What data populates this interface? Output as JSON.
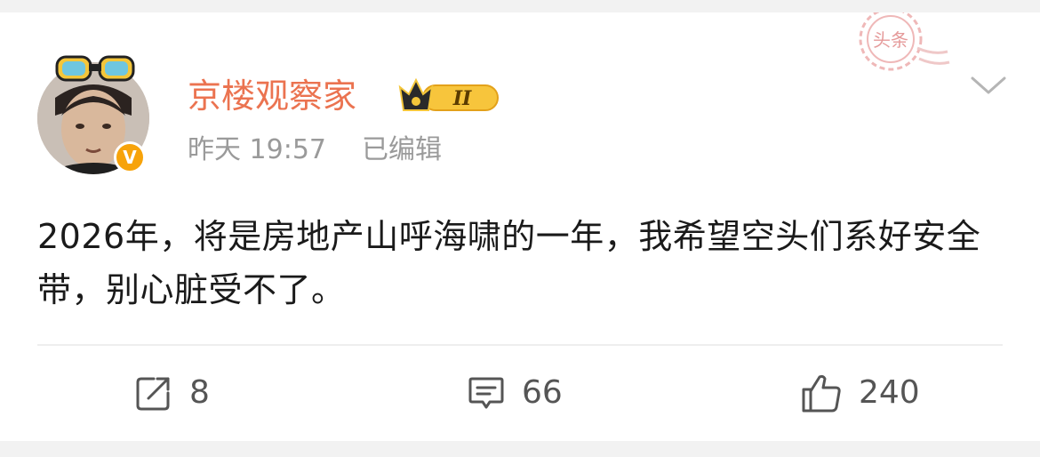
{
  "post": {
    "author": {
      "name": "京楼观察家",
      "verified_icon": "verified-v-badge",
      "verified_label": "V",
      "membership_icon": "crown-vip-badge",
      "membership_level": "II"
    },
    "time": "昨天 19:57",
    "edited_label": "已编辑",
    "headline_stamp_label": "头条",
    "text": "2026年，将是房地产山呼海啸的一年，我希望空头们系好安全带，别心脏受不了。"
  },
  "actions": {
    "repost": {
      "icon": "repost-icon",
      "count": "8"
    },
    "comment": {
      "icon": "comment-icon",
      "count": "66"
    },
    "like": {
      "icon": "thumbs-up-icon",
      "count": "240"
    }
  },
  "colors": {
    "username": "#eb7350",
    "meta": "#9a9a9a",
    "text": "#1a1a1a",
    "badge_orange": "#f7a30a",
    "stamp_red": "#e8a5a5"
  }
}
